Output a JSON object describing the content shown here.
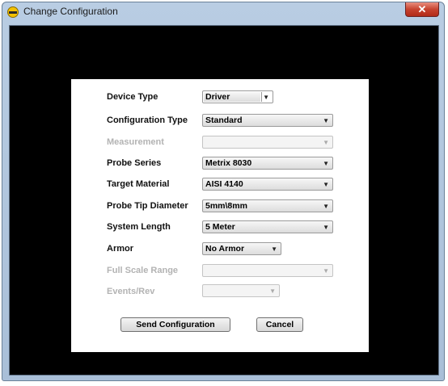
{
  "window": {
    "title": "Change Configuration",
    "close_label": "✕"
  },
  "form": {
    "device_type": {
      "label": "Device Type",
      "value": "Driver"
    },
    "configuration_type": {
      "label": "Configuration Type",
      "value": "Standard"
    },
    "measurement": {
      "label": "Measurement",
      "value": ""
    },
    "probe_series": {
      "label": "Probe Series",
      "value": "Metrix 8030"
    },
    "target_material": {
      "label": "Target Material",
      "value": "AISI 4140"
    },
    "probe_tip_diameter": {
      "label": "Probe Tip Diameter",
      "value": "5mm\\8mm"
    },
    "system_length": {
      "label": "System Length",
      "value": "5 Meter"
    },
    "armor": {
      "label": "Armor",
      "value": "No Armor"
    },
    "full_scale_range": {
      "label": "Full Scale Range",
      "value": ""
    },
    "events_rev": {
      "label": "Events/Rev",
      "value": ""
    }
  },
  "buttons": {
    "send_configuration": "Send Configuration",
    "cancel": "Cancel"
  },
  "icons": {
    "dropdown_arrow": "▼",
    "app": "app-icon"
  },
  "colors": {
    "disabled_text": "#b3b3b3",
    "close_button": "#c7432f",
    "client_background": "#000000"
  }
}
